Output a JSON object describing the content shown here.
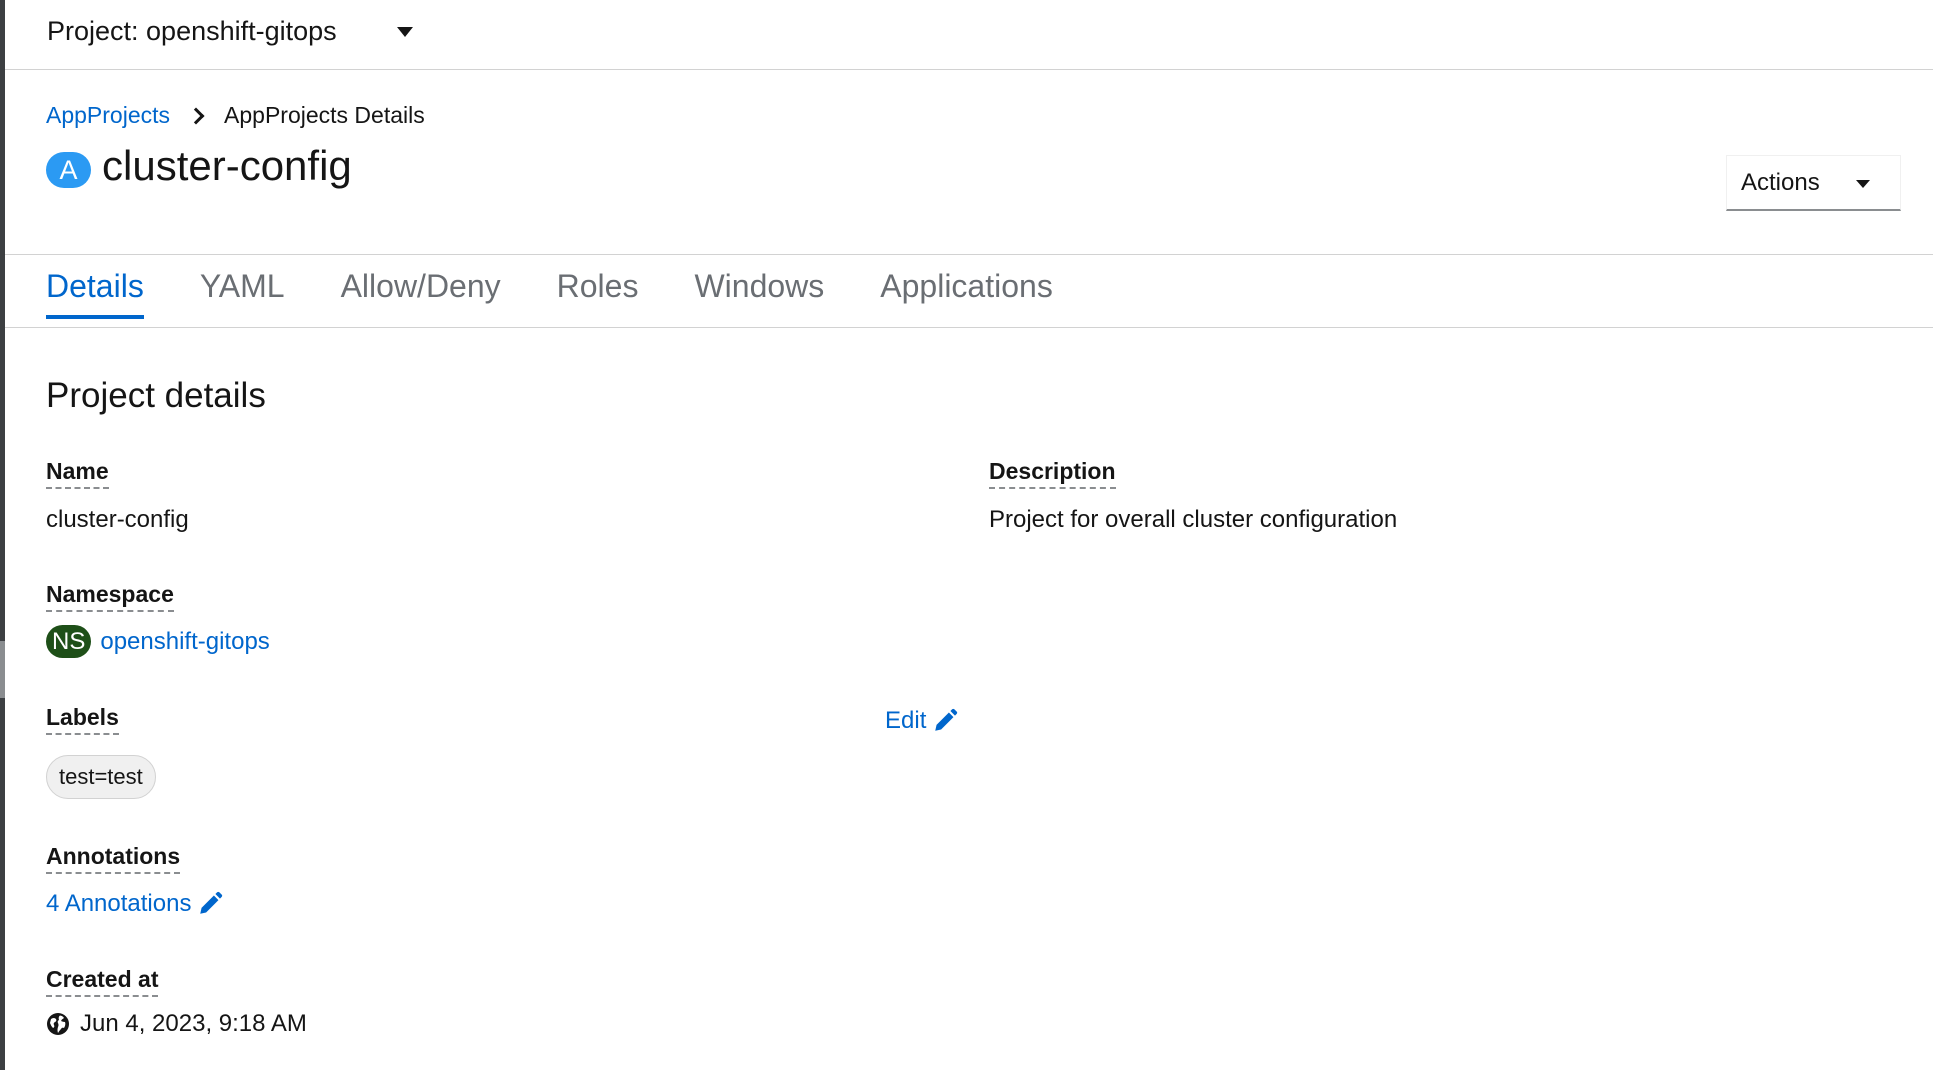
{
  "project_bar": {
    "label": "Project: openshift-gitops"
  },
  "breadcrumb": {
    "parent": "AppProjects",
    "current": "AppProjects Details"
  },
  "header": {
    "badge": "A",
    "title": "cluster-config",
    "actions_label": "Actions"
  },
  "tabs": [
    {
      "label": "Details",
      "active": true
    },
    {
      "label": "YAML"
    },
    {
      "label": "Allow/Deny"
    },
    {
      "label": "Roles"
    },
    {
      "label": "Windows"
    },
    {
      "label": "Applications"
    }
  ],
  "details": {
    "section_title": "Project details",
    "name_label": "Name",
    "name_value": "cluster-config",
    "description_label": "Description",
    "description_value": "Project for overall cluster configuration",
    "namespace_label": "Namespace",
    "namespace_badge": "NS",
    "namespace_value": "openshift-gitops",
    "labels_label": "Labels",
    "labels_edit": "Edit",
    "labels": [
      "test=test"
    ],
    "annotations_label": "Annotations",
    "annotations_link": "4 Annotations",
    "created_label": "Created at",
    "created_value": "Jun 4, 2023, 9:18 AM"
  },
  "colors": {
    "accent": "#0066cc",
    "app_badge": "#2b9af3",
    "ns_badge": "#1e4f18"
  },
  "icons": {
    "edit": "pencil-icon",
    "created": "globe-icon",
    "project_dropdown": "caret-down-icon"
  }
}
